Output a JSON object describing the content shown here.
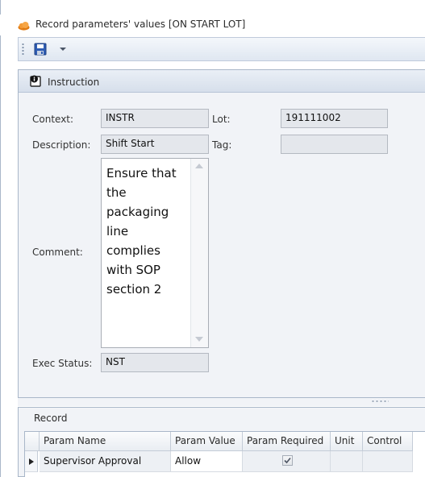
{
  "window": {
    "title": "Record parameters' values    [ON START LOT]"
  },
  "toolbar": {
    "icons": [
      "save-icon",
      "chevron-down-icon"
    ]
  },
  "instruction": {
    "title": "Instruction",
    "context_label": "Context:",
    "context_value": "INSTR",
    "lot_label": "Lot:",
    "lot_value": "191111002",
    "description_label": "Description:",
    "description_value": "Shift Start",
    "tag_label": "Tag:",
    "tag_value": "",
    "comment_label": "Comment:",
    "comment_value": "Ensure that\nthe\npackaging\nline\ncomplies\nwith SOP\nsection 2",
    "exec_status_label": "Exec Status:",
    "exec_status_value": "NST"
  },
  "record": {
    "title": "Record",
    "columns": [
      "Param Name",
      "Param Value",
      "Param Required",
      "Unit",
      "Control"
    ],
    "rows": [
      {
        "param_name": "Supervisor Approval",
        "param_value": "Allow",
        "param_required": true,
        "unit": "",
        "control": ""
      }
    ]
  },
  "colors": {
    "frame_border": "#a9b7c9",
    "panel_background": "#f1f3f7",
    "readonly_field": "#e4e7ec",
    "title_icon": "#e8841c"
  }
}
